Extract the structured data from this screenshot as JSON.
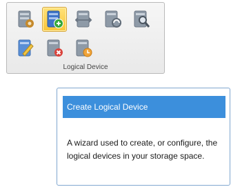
{
  "ribbon": {
    "group_label": "Logical Device",
    "buttons": [
      {
        "icon": "device-settings-icon",
        "selected": false
      },
      {
        "icon": "create-logical-device-icon",
        "selected": true
      },
      {
        "icon": "device-exchange-icon",
        "selected": false
      },
      {
        "icon": "device-refresh-icon",
        "selected": false
      },
      {
        "icon": "device-search-icon",
        "selected": false
      },
      {
        "icon": "device-edit-icon",
        "selected": false
      },
      {
        "icon": "device-delete-icon",
        "selected": false
      },
      {
        "icon": "device-clock-icon",
        "selected": false
      }
    ]
  },
  "tooltip": {
    "title": "Create Logical Device",
    "description": "A wizard used to create, or configure, the logical devices in your storage space."
  },
  "colors": {
    "tooltip_header": "#3c8fdc",
    "selected_button": "#f8c53a",
    "device_gray": "#8e9aa7",
    "device_blue": "#3f74c8",
    "badge_green": "#35a83a",
    "badge_red": "#d9433c",
    "badge_orange": "#f0a43a"
  }
}
